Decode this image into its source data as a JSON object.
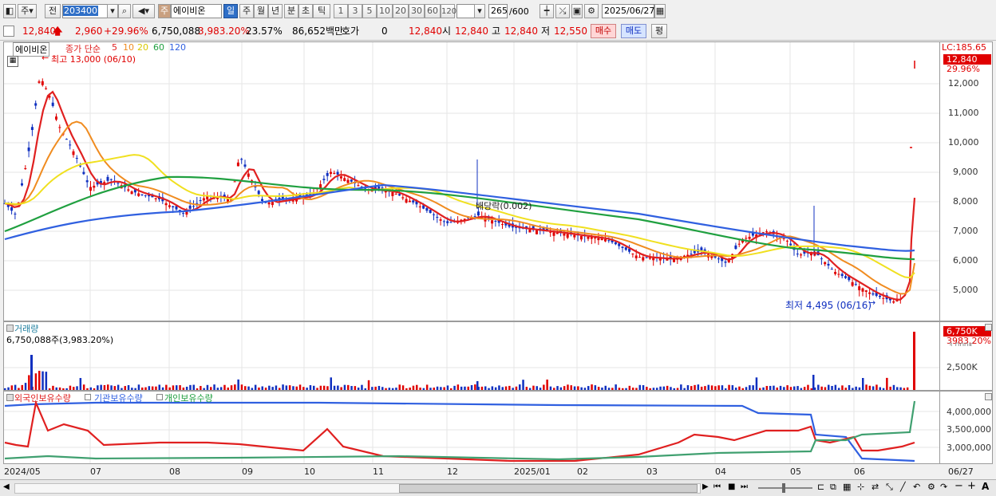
{
  "toolbar": {
    "tab_day": "주",
    "prev_label": "전",
    "code": "203400",
    "stock_tag": "주",
    "stock_name": "에이비온",
    "period_buttons": [
      "일",
      "주",
      "월",
      "년",
      "분",
      "초",
      "틱"
    ],
    "interval_buttons": [
      "1",
      "3",
      "5",
      "10",
      "20",
      "30",
      "60",
      "120"
    ],
    "count": "265",
    "count_total": "/600",
    "date": "2025/06/27"
  },
  "quote": {
    "price": "12,840",
    "change": "2,960",
    "change_pct": "+29.96%",
    "volume": "6,750,088",
    "volume_pct": "3,983.20%",
    "turnover_pct": "23.57%",
    "amount": "86,652백만",
    "hoga_label": "호가",
    "hoga_value": "0",
    "hoga_price": "12,840",
    "open_label": "시",
    "open": "12,840",
    "high_label": "고",
    "high": "12,840",
    "low_label": "저",
    "low": "12,550",
    "buy_label": "매수",
    "sell_label": "매도",
    "even_label": "평"
  },
  "price_pane": {
    "name_tag": "에이비온",
    "ma_title": "종가 단순",
    "ma_periods": [
      "5",
      "10",
      "20",
      "60",
      "120"
    ],
    "ma_colors": [
      "#e02020",
      "#f08c20",
      "#f0e020",
      "#20a040",
      "#3060e0"
    ],
    "max_note": "최고 13,000 (06/10)",
    "min_note": "최저 4,495 (06/16)",
    "ex_note": "배당락(0.002)",
    "lc_label": "LC:185.65",
    "last_price_tag": "12,840",
    "last_pct_tag": "29.96%",
    "y_ticks": [
      "12,000",
      "11,000",
      "10,000",
      "9,000",
      "8,000",
      "7,000",
      "6,000",
      "5,000"
    ]
  },
  "volume_pane": {
    "title": "거래량",
    "summary": "6,750,088주(3,983.20%)",
    "tag_value": "6,750K",
    "tag_pct": "3983.20%",
    "tick_hidden": "3,000K",
    "y_ticks": [
      "2,500K"
    ]
  },
  "holding_pane": {
    "legend": [
      "외국인보유수량",
      "기관보유수량",
      "개인보유수량"
    ],
    "legend_colors": [
      "#e02020",
      "#3060e0",
      "#20a040"
    ],
    "y_ticks": [
      "4,000,000",
      "3,500,000",
      "3,000,000"
    ]
  },
  "x_labels": [
    "2024/05",
    "07",
    "08",
    "09",
    "10",
    "11",
    "12",
    "2025/01",
    "02",
    "03",
    "04",
    "05",
    "06"
  ],
  "x_right_label": "06/27"
}
